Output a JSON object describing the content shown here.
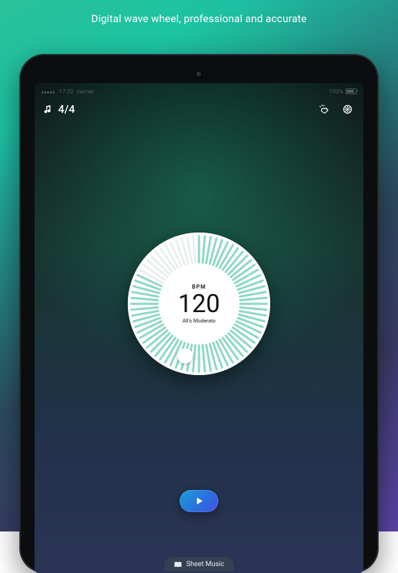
{
  "caption": "Digital wave wheel, professional and accurate",
  "statusbar": {
    "time": "17:22",
    "carrier": "carrier",
    "battery_pct": "100%"
  },
  "topbar": {
    "time_signature": "4/4",
    "icons": {
      "note": "note-icon",
      "tap": "tap-tempo-icon",
      "settings": "gear-icon"
    }
  },
  "wheel": {
    "bpm_label": "BPM",
    "bpm_value": "120",
    "tempo_name": "All'o Moderato",
    "ticks_total": 72,
    "active_until": 60,
    "knob_angle_deg": 105,
    "colors": {
      "tick_active": "#8fd8c6",
      "tick_inactive": "#e9efee",
      "face": "#ffffff"
    }
  },
  "controls": {
    "play_label": "Play",
    "sheet_music_label": "Sheet Music"
  }
}
